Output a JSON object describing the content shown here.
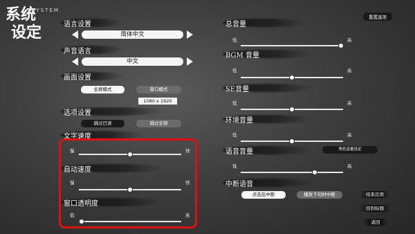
{
  "header": {
    "title_line1": "系统",
    "title_line2": "设定",
    "system": "SYSTEM",
    "reset": "重置选项"
  },
  "left": {
    "text_language": {
      "label": "语言设置",
      "value": "简体中文"
    },
    "voice_language": {
      "label": "声音语言",
      "value": "中文"
    },
    "display": {
      "label": "画面设置",
      "fullscreen": "全屏模式",
      "windowed": "窗口模式",
      "resolution": "1080 x 1920"
    },
    "skip": {
      "label": "选项设置",
      "read_only": "跳过已读",
      "skip_all": "跳过全部"
    },
    "text_speed": {
      "label": "文字速度",
      "min": "慢",
      "max": "快",
      "value": 0.5
    },
    "auto_speed": {
      "label": "自动速度",
      "min": "慢",
      "max": "快",
      "value": 0.5
    },
    "window_opacity": {
      "label": "窗口透明度",
      "min": "低",
      "max": "高",
      "value": 0.03
    }
  },
  "right": {
    "master": {
      "label": "总音量",
      "min": "低",
      "max": "高",
      "value": 0.98
    },
    "bgm": {
      "label": "BGM 音量",
      "min": "低",
      "max": "高",
      "value": 0.5
    },
    "se": {
      "label": "SE音量",
      "min": "低",
      "max": "高",
      "value": 0.5
    },
    "env": {
      "label": "环境音量",
      "min": "低",
      "max": "高",
      "value": 0.5
    },
    "voice": {
      "label": "语音音量",
      "min": "低",
      "max": "高",
      "value": 0.72,
      "char_button": "角色音量设定"
    },
    "interrupt": {
      "label": "中断语音",
      "click": "点击后中断",
      "next": "播放下句时中断"
    }
  },
  "side_buttons": {
    "end": "结束应用",
    "title": "回到标题",
    "back": "返回"
  }
}
